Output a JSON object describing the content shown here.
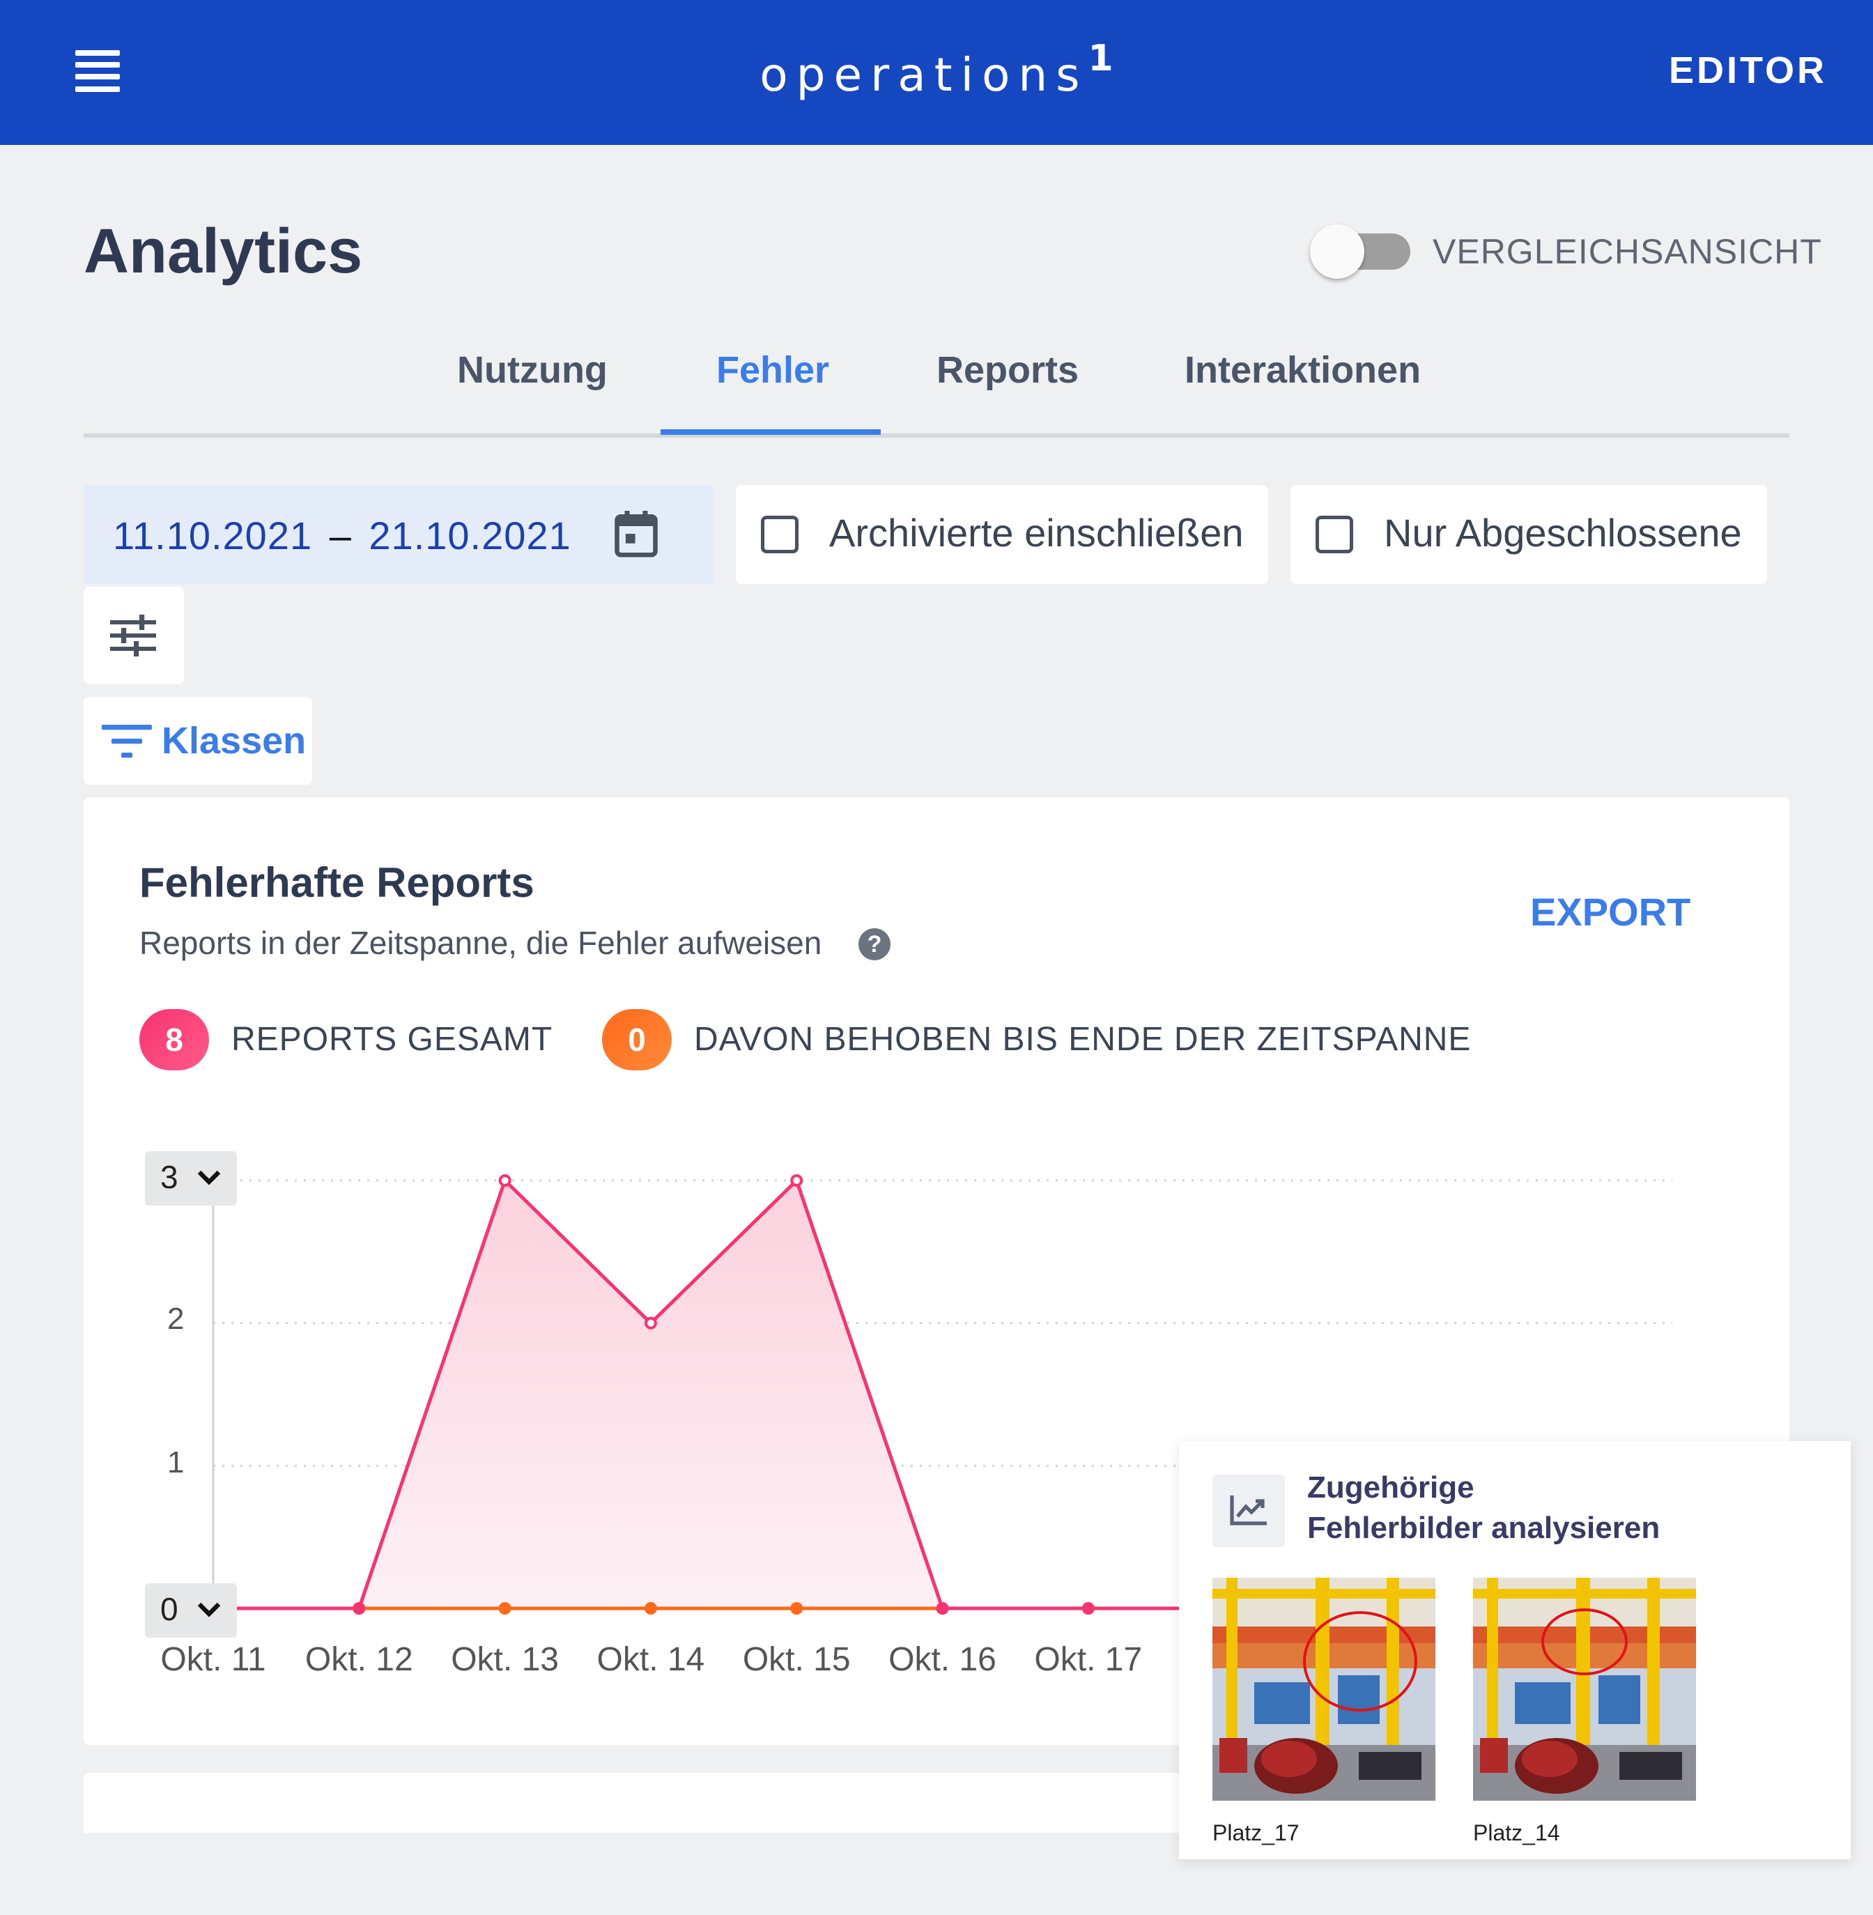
{
  "header": {
    "menu_icon": "hamburger-menu-icon",
    "logo_text": "operations",
    "logo_sup": "1",
    "editor_label": "EDITOR"
  },
  "page": {
    "title": "Analytics",
    "compare_toggle_label": "VERGLEICHSANSICHT",
    "compare_toggle_on": false
  },
  "tabs": [
    {
      "label": "Nutzung",
      "active": false
    },
    {
      "label": "Fehler",
      "active": true
    },
    {
      "label": "Reports",
      "active": false
    },
    {
      "label": "Interaktionen",
      "active": false
    }
  ],
  "filters": {
    "date_start": "11.10.2021",
    "date_sep": "–",
    "date_end": "21.10.2021",
    "calendar_icon": "calendar-icon",
    "archived_label": "Archivierte einschließen",
    "archived_checked": false,
    "completed_label": "Nur Abgeschlossene",
    "completed_checked": false,
    "tune_icon": "tune-sliders-icon",
    "classes_label": "Klassen",
    "classes_icon": "filter-list-icon"
  },
  "card": {
    "title": "Fehlerhafte Reports",
    "subtitle": "Reports in der Zeitspanne, die Fehler aufweisen",
    "help_icon": "help-circle-icon",
    "help_glyph": "?",
    "export_label": "EXPORT",
    "stats": [
      {
        "value": "8",
        "label": "REPORTS GESAMT",
        "color": "#f7346f"
      },
      {
        "value": "0",
        "label": "DAVON BEHOBEN BIS ENDE DER ZEITSPANNE",
        "color": "#ff6a1a"
      }
    ],
    "y_max_select": "3",
    "y_min_select": "0"
  },
  "chart_data": {
    "type": "area",
    "x": [
      "Okt. 11",
      "Okt. 12",
      "Okt. 13",
      "Okt. 14",
      "Okt. 15",
      "Okt. 16",
      "Okt. 17"
    ],
    "series": [
      {
        "name": "REPORTS GESAMT",
        "color": "#f7346f",
        "values": [
          0,
          0,
          3,
          2,
          3,
          0,
          0
        ]
      },
      {
        "name": "DAVON BEHOBEN BIS ENDE DER ZEITSPANNE",
        "color": "#ff6a1a",
        "values": [
          0,
          0,
          0,
          0,
          0,
          0,
          0
        ]
      }
    ],
    "yticks": [
      "3",
      "2",
      "1",
      "0"
    ],
    "ylim": [
      0,
      3
    ],
    "grid": "dotted horizontal"
  },
  "popup": {
    "icon": "trending-up-chart-icon",
    "title_line1": "Zugehörige",
    "title_line2": "Fehlerbilder analysieren",
    "images": [
      {
        "label": "Platz_17"
      },
      {
        "label": "Platz_14"
      }
    ]
  }
}
